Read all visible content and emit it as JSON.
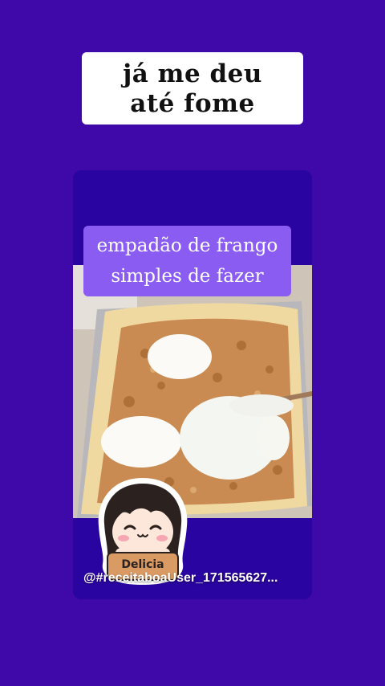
{
  "caption": {
    "line1": "já me deu",
    "line2": "até fome"
  },
  "video": {
    "title_line1": "empadão de frango",
    "title_line2": "simples de fazer",
    "handle": "@#receitaboaUser_171565627..."
  },
  "sticker": {
    "label": "Delicia",
    "icon": "chibi-girl-avatar-icon"
  },
  "colors": {
    "background": "#3f08a8",
    "card": "#2a04a0",
    "title_box": "#8a5cf2"
  }
}
